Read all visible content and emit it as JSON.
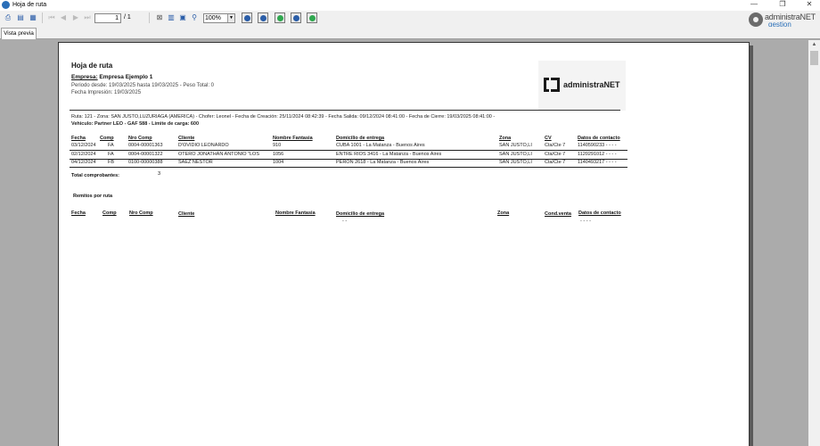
{
  "window": {
    "title": "Hoja de ruta",
    "minimize": "—",
    "restore": "❐",
    "close": "✕"
  },
  "toolbar": {
    "current_page": "1",
    "page_total": "/ 1",
    "zoom": "100%",
    "zoom_arrow": "▼",
    "icons": [
      "printer-icon",
      "print-setup-icon",
      "export-icon",
      "first-page-icon",
      "prev-page-icon",
      "next-page-icon",
      "last-page-icon",
      "close-preview-icon",
      "group-tree-icon",
      "search-icon",
      "refresh-icon"
    ]
  },
  "brand": {
    "line1": "administraNET",
    "line2": "gestion"
  },
  "tabs": [
    {
      "label": "Vista previa"
    }
  ],
  "report": {
    "title": "Hoja de ruta",
    "empresa_label": "Empresa:",
    "empresa_value": " Empresa Ejemplo 1",
    "periodo": "Periodo desde: 19/03/2025 hasta 19/03/2025 - Peso Total: 0",
    "fecha_impresion": "Fecha Impresión: 19/03/2025",
    "logo_text": "administraNET",
    "ruta_line": "Ruta: 121 - Zona: SAN JUSTO,LUZURIAGA (AMERICA) - Chofer: Leonel - Fecha de Creación: 25/11/2024  08:42:39 - Fecha Salida: 09/12/2024  08:41:00 - Fecha de Cierre: 19/03/2025  08:41:00 -",
    "vehiculo_line": "Vehiculo: Partner LEO - GAF 588 - Limite de carga: 600",
    "columns": [
      "Fecha",
      "Comp",
      "Nro Comp",
      "Cliente",
      "Nombre Fantasia",
      "Domicilio de entrega",
      "Zona",
      "CV",
      "Datos de contacto"
    ],
    "rows": [
      [
        "03/12/2024",
        "FA",
        "0004-00001363",
        "D'OVIDIO LEONARDO",
        "910",
        "CUBA 1001  - La Matanza - Buenos Aires",
        "SAN JUSTO,LI",
        "Cta/Cte 7",
        "1140590233 - - - -"
      ],
      [
        "02/12/2024",
        "FA",
        "0004-00001322",
        "OTERO JONATHAN ANTONIO \"LOS",
        "1056",
        "ENTRE RIOS 3416  - La Matanza - Buenos Aires",
        "SAN JUSTO,LI",
        "Cta/Cte 7",
        "1120291012 - - - -"
      ],
      [
        "04/12/2024",
        "FB",
        "0100-00000388",
        "SAEZ NESTOR",
        "1004",
        "PERON 2618  - La Matanza - Buenos Aires",
        "SAN JUSTO,LI",
        "Cta/Cte 7",
        "1140493217 - - - -"
      ]
    ],
    "total_label": "Total comprobantes:",
    "total_value": "3",
    "remitos_title": "Remitos por ruta",
    "remitos_columns": [
      "Fecha",
      "Comp",
      "Nro Comp",
      "Cliente",
      "Nombre Fantasia",
      "Domicilio de entrega",
      "Zona",
      "Cond.venta",
      "Datos de contacto"
    ],
    "remitos_dashes_a": "- -",
    "remitos_dashes_b": "- - - -"
  },
  "colors": {
    "accent": "#2a6fb8",
    "workspace": "#ababab"
  }
}
